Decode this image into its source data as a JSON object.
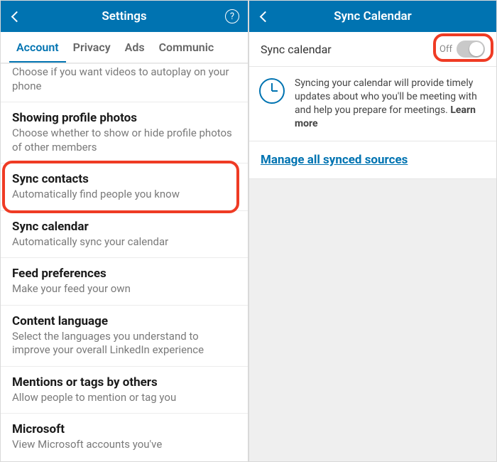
{
  "left": {
    "header": {
      "title": "Settings"
    },
    "tabs": [
      "Account",
      "Privacy",
      "Ads",
      "Communic"
    ],
    "activeTab": 0,
    "topPartialSub": "Choose if you want videos to autoplay on your phone",
    "rows": [
      {
        "title": "Showing profile photos",
        "sub": "Choose whether to show or hide profile photos of other members"
      },
      {
        "title": "Sync contacts",
        "sub": "Automatically find people you know",
        "highlight": true
      },
      {
        "title": "Sync calendar",
        "sub": "Automatically sync your calendar"
      },
      {
        "title": "Feed preferences",
        "sub": "Make your feed your own"
      },
      {
        "title": "Content language",
        "sub": "Select the languages you understand to improve your overall LinkedIn experience"
      },
      {
        "title": "Mentions or tags by others",
        "sub": "Allow people to mention or tag you"
      },
      {
        "title": "Microsoft",
        "sub": "View Microsoft accounts you've"
      }
    ]
  },
  "right": {
    "header": {
      "title": "Sync Calendar"
    },
    "syncRow": {
      "label": "Sync calendar",
      "state": "Off"
    },
    "info": {
      "text": "Syncing your calendar will provide timely updates about who you'll be meeting with and help you prepare for meetings. ",
      "learn": "Learn more"
    },
    "manage": "Manage all synced sources"
  }
}
